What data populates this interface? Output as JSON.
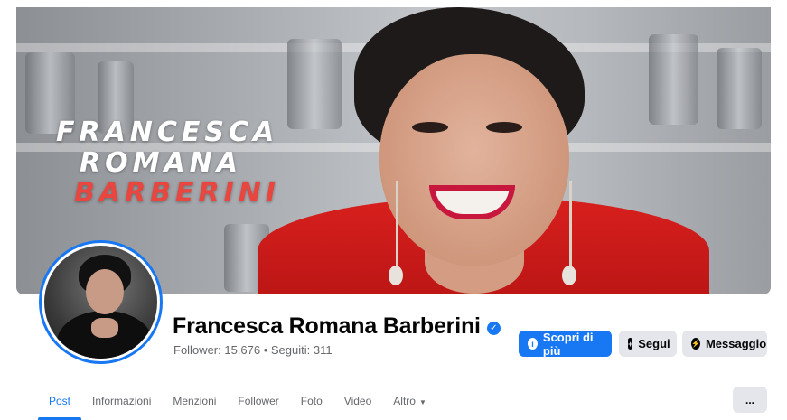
{
  "cover": {
    "text_line1": "FRANCESCA",
    "text_line2": "ROMANA",
    "text_line3": "BARBERINI"
  },
  "profile": {
    "name": "Francesca Romana Barberini",
    "followers_text": "Follower: 15.676 • Seguiti: 311",
    "verified_icon": "verified-check-icon"
  },
  "actions": {
    "learn_more": "Scopri di più",
    "follow": "Segui",
    "message": "Messaggio"
  },
  "tabs": {
    "items": [
      {
        "label": "Post",
        "active": true
      },
      {
        "label": "Informazioni"
      },
      {
        "label": "Menzioni"
      },
      {
        "label": "Follower"
      },
      {
        "label": "Foto"
      },
      {
        "label": "Video"
      },
      {
        "label": "Altro"
      }
    ],
    "more_label": "..."
  },
  "colors": {
    "accent": "#1877f2",
    "cover_red_text": "#e8463f",
    "jacket_red": "#d8201e",
    "button_gray": "#e4e6eb",
    "secondary_text": "#65676b"
  }
}
